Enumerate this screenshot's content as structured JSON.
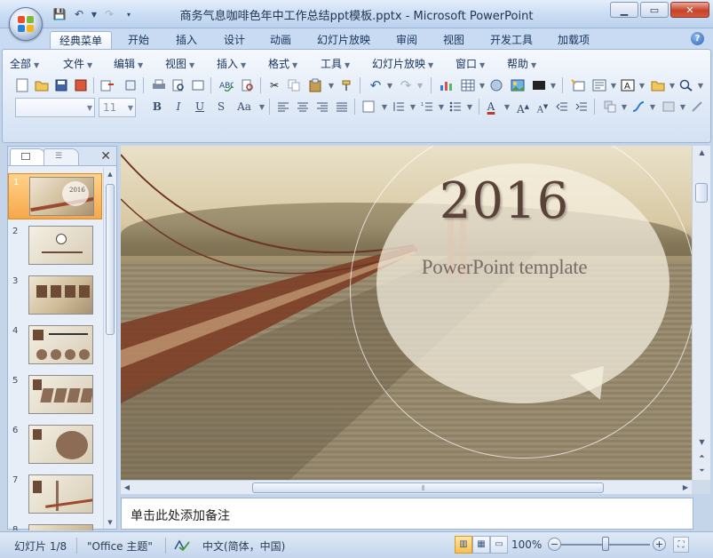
{
  "window": {
    "title": "商务气息咖啡色年中工作总结ppt模板.pptx - Microsoft PowerPoint"
  },
  "ribbon": {
    "tabs": [
      {
        "label": "经典菜单",
        "active": true
      },
      {
        "label": "开始"
      },
      {
        "label": "插入"
      },
      {
        "label": "设计"
      },
      {
        "label": "动画"
      },
      {
        "label": "幻灯片放映"
      },
      {
        "label": "审阅"
      },
      {
        "label": "视图"
      },
      {
        "label": "开发工具"
      },
      {
        "label": "加载项"
      }
    ],
    "menus": [
      "全部",
      "文件",
      "编辑",
      "视图",
      "插入",
      "格式",
      "工具",
      "幻灯片放映",
      "窗口",
      "帮助"
    ],
    "font_name": "",
    "font_size": "11"
  },
  "thumbnails": {
    "items": [
      "1",
      "2",
      "3",
      "4",
      "5",
      "6",
      "7",
      "8"
    ],
    "selected": "1"
  },
  "slide": {
    "year": "2016",
    "subtitle": "PowerPoint template"
  },
  "notes": {
    "placeholder": "单击此处添加备注"
  },
  "status": {
    "slide_counter": "幻灯片 1/8",
    "theme": "\"Office 主题\"",
    "language": "中文(简体，中国)",
    "zoom": "100%"
  },
  "colors": {
    "accent_brown": "#5a4238",
    "selected_thumb": "#f7a74a",
    "ribbon_blue": "#c9dbf2"
  }
}
